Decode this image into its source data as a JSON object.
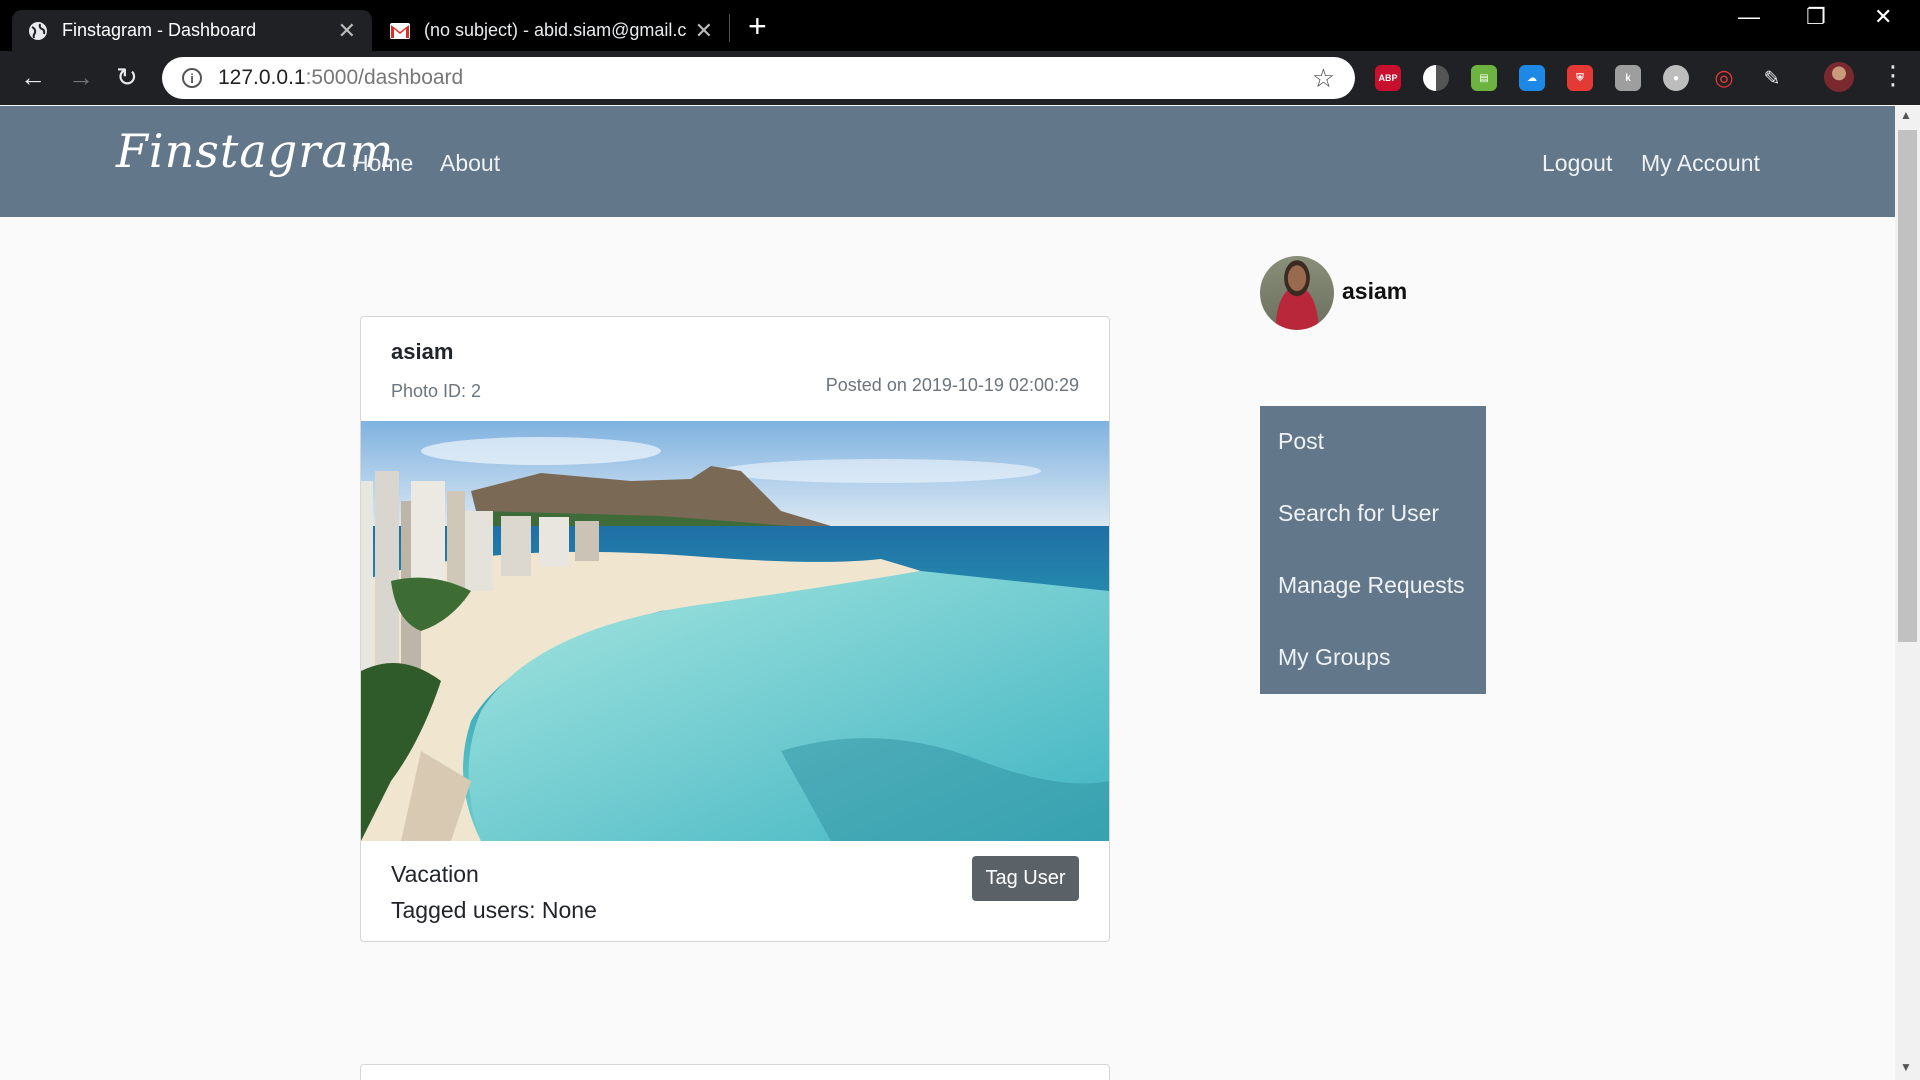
{
  "browser": {
    "tabs": [
      {
        "title": "Finstagram - Dashboard",
        "active": true
      },
      {
        "title": "(no subject) - abid.siam@gmail.c",
        "active": false
      }
    ],
    "url_host": "127.0.0.1",
    "url_path": ":5000/dashboard",
    "extensions": [
      "ABP",
      "dark-mode",
      "printer",
      "cloud",
      "shield",
      "k",
      "record",
      "target",
      "pen"
    ]
  },
  "navbar": {
    "brand": "Finstagram",
    "left_links": [
      "Home",
      "About"
    ],
    "right_links": [
      "Logout",
      "My Account"
    ],
    "color": "#627789"
  },
  "post": {
    "username": "asiam",
    "photo_id": "Photo ID: 2",
    "posted_on": "Posted on 2019-10-19 02:00:29",
    "caption": "Vacation",
    "tagged_users": "Tagged users: None",
    "tag_button": "Tag User"
  },
  "sidebar": {
    "username": "asiam",
    "menu": [
      "Post",
      "Search for User",
      "Manage Requests",
      "My Groups"
    ]
  }
}
